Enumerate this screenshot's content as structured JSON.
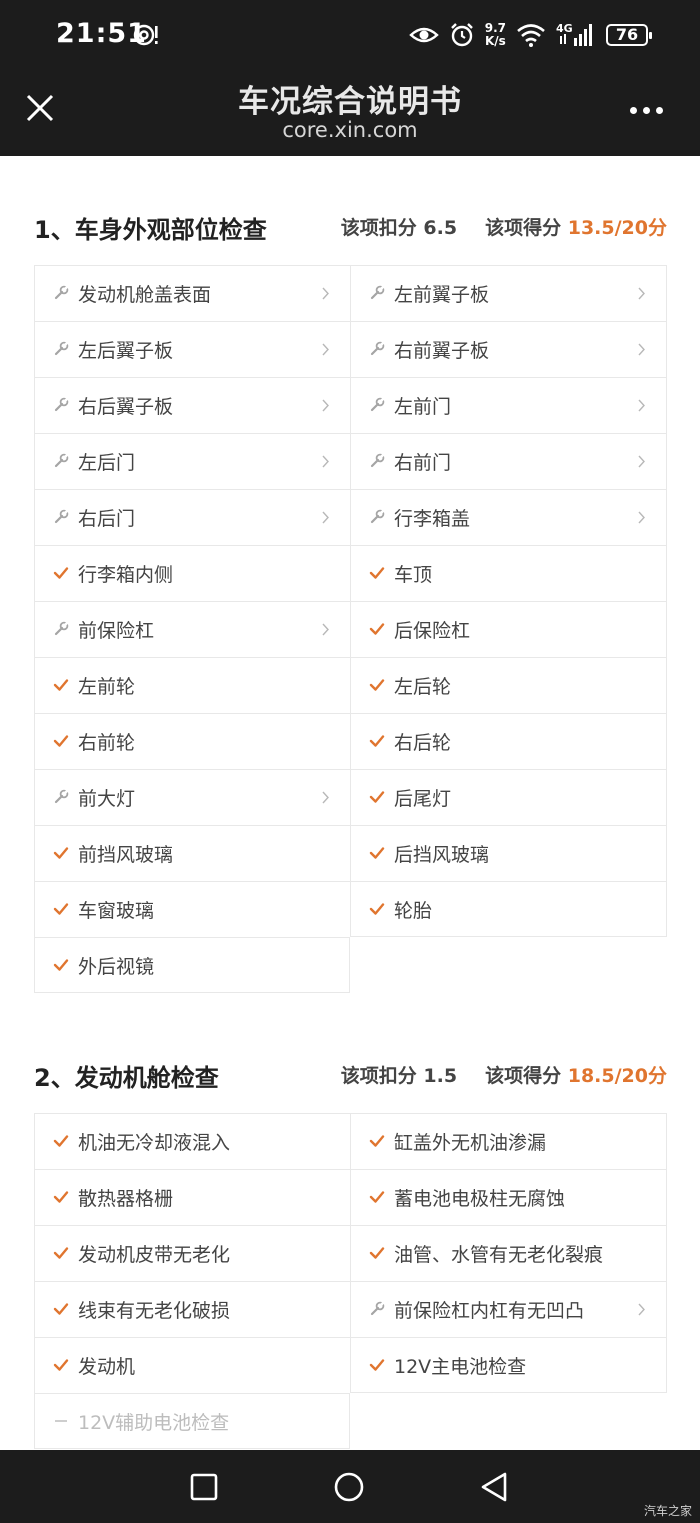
{
  "status_bar": {
    "time": "21:51",
    "net_speed_value": "9.7",
    "net_speed_unit": "K/s",
    "network": "4G",
    "battery": "76",
    "icons": [
      "alert-icon",
      "eye-icon",
      "alarm-icon",
      "wifi-icon",
      "signal-icon",
      "battery-icon"
    ]
  },
  "header": {
    "title": "车况综合说明书",
    "subtitle": "core.xin.com"
  },
  "sections": [
    {
      "title": "1、车身外观部位检查",
      "deduct_label": "该项扣分",
      "deduct_value": "6.5",
      "score_label": "该项得分",
      "score_value": "13.5/20分",
      "items": [
        {
          "label": "发动机舱盖表面",
          "status": "repair"
        },
        {
          "label": "左前翼子板",
          "status": "repair"
        },
        {
          "label": "左后翼子板",
          "status": "repair"
        },
        {
          "label": "右前翼子板",
          "status": "repair"
        },
        {
          "label": "右后翼子板",
          "status": "repair"
        },
        {
          "label": "左前门",
          "status": "repair"
        },
        {
          "label": "左后门",
          "status": "repair"
        },
        {
          "label": "右前门",
          "status": "repair"
        },
        {
          "label": "右后门",
          "status": "repair"
        },
        {
          "label": "行李箱盖",
          "status": "repair"
        },
        {
          "label": "行李箱内侧",
          "status": "ok"
        },
        {
          "label": "车顶",
          "status": "ok"
        },
        {
          "label": "前保险杠",
          "status": "repair"
        },
        {
          "label": "后保险杠",
          "status": "ok"
        },
        {
          "label": "左前轮",
          "status": "ok"
        },
        {
          "label": "左后轮",
          "status": "ok"
        },
        {
          "label": "右前轮",
          "status": "ok"
        },
        {
          "label": "右后轮",
          "status": "ok"
        },
        {
          "label": "前大灯",
          "status": "repair"
        },
        {
          "label": "后尾灯",
          "status": "ok"
        },
        {
          "label": "前挡风玻璃",
          "status": "ok"
        },
        {
          "label": "后挡风玻璃",
          "status": "ok"
        },
        {
          "label": "车窗玻璃",
          "status": "ok"
        },
        {
          "label": "轮胎",
          "status": "ok"
        },
        {
          "label": "外后视镜",
          "status": "ok"
        }
      ]
    },
    {
      "title": "2、发动机舱检查",
      "deduct_label": "该项扣分",
      "deduct_value": "1.5",
      "score_label": "该项得分",
      "score_value": "18.5/20分",
      "items": [
        {
          "label": "机油无冷却液混入",
          "status": "ok"
        },
        {
          "label": "缸盖外无机油渗漏",
          "status": "ok"
        },
        {
          "label": "散热器格栅",
          "status": "ok"
        },
        {
          "label": "蓄电池电极柱无腐蚀",
          "status": "ok"
        },
        {
          "label": "发动机皮带无老化",
          "status": "ok"
        },
        {
          "label": "油管、水管有无老化裂痕",
          "status": "ok"
        },
        {
          "label": "线束有无老化破损",
          "status": "ok"
        },
        {
          "label": "前保险杠内杠有无凹凸",
          "status": "repair"
        },
        {
          "label": "发动机",
          "status": "ok"
        },
        {
          "label": "12V主电池检查",
          "status": "ok"
        },
        {
          "label": "12V辅助电池检查",
          "status": "na"
        }
      ]
    }
  ],
  "colors": {
    "accent": "#e0752f",
    "repair_icon": "#a5a5a5",
    "bar_bg": "#1c1c1c"
  },
  "nav": {
    "buttons": [
      "recent-apps-icon",
      "home-icon",
      "back-icon"
    ]
  },
  "watermark": "汽车之家"
}
